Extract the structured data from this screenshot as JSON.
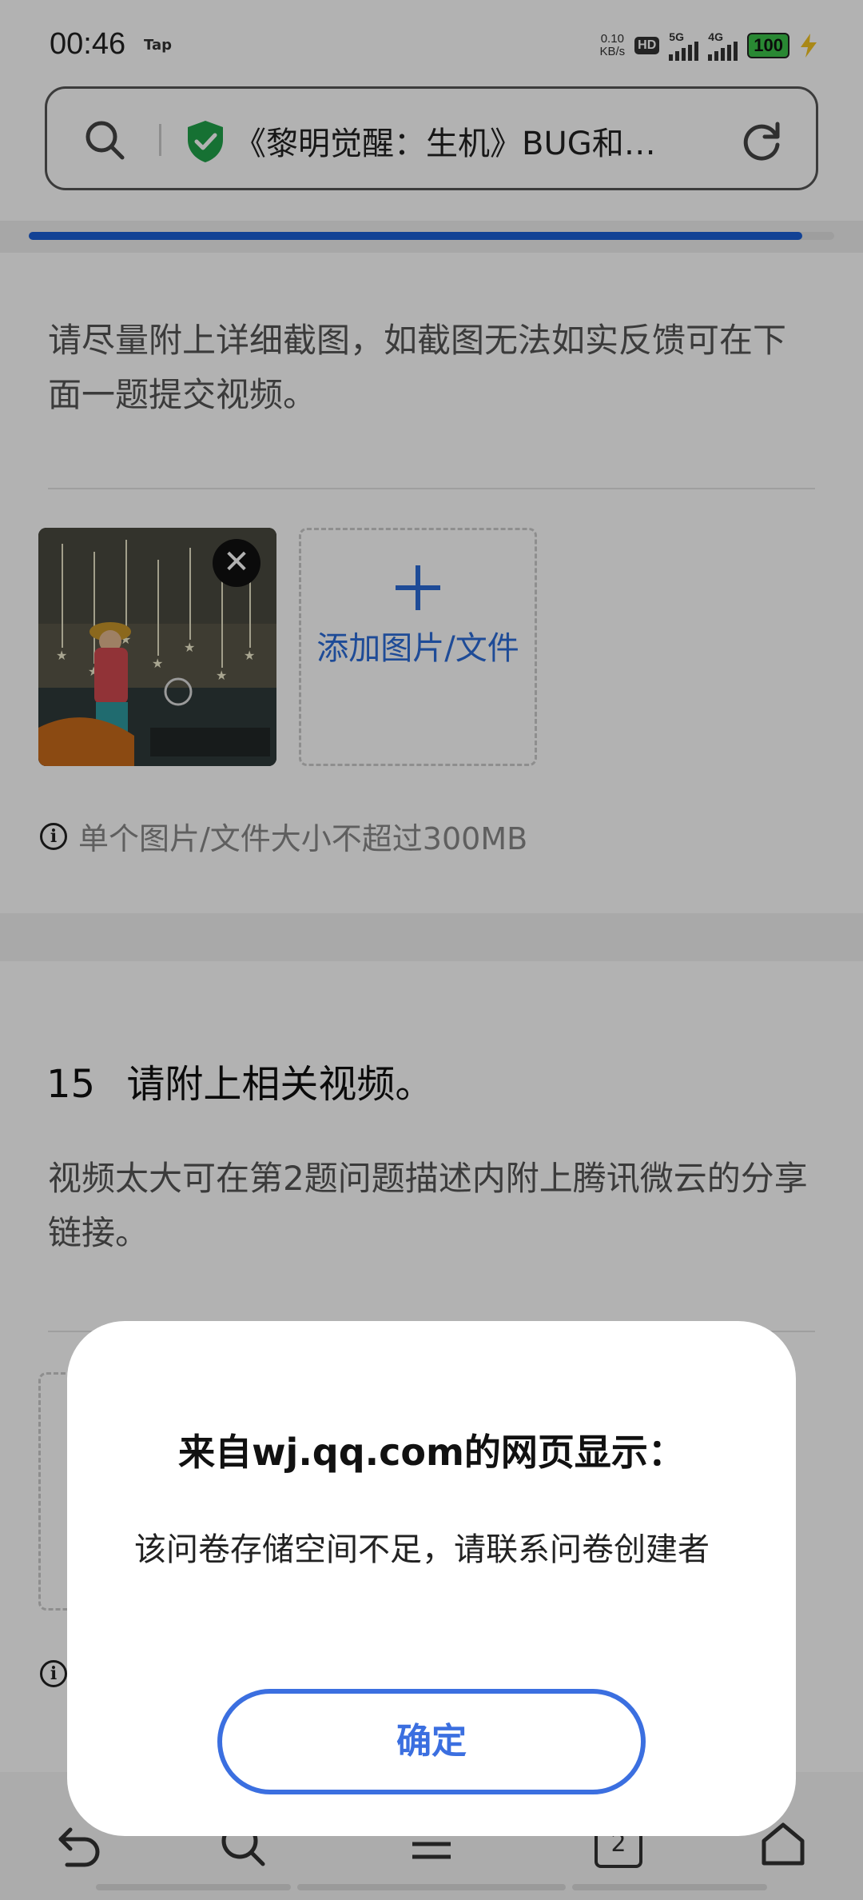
{
  "status_bar": {
    "time": "00:46",
    "tap_label": "Tap",
    "net_speed_value": "0.10",
    "net_speed_unit": "KB/s",
    "hd": "HD",
    "sim1_network": "5G",
    "sim2_network": "4G",
    "battery": "100"
  },
  "url_bar": {
    "title": "《黎明觉醒：生机》BUG和…",
    "secure_icon": "shield-check-icon",
    "security_color": "#20a24a"
  },
  "page_load_progress": 0.96,
  "question_13": {
    "description": "请尽量附上详细截图，如截图无法如实反馈可在下面一题提交视频。",
    "add_file_label": "添加图片/文件",
    "size_note": "单个图片/文件大小不超过300MB"
  },
  "question_14": {
    "number": "15",
    "title": "请附上相关视频。",
    "description": "视频太大可在第2题问题描述内附上腾讯微云的分享链接。"
  },
  "dialog": {
    "title": "来自wj.qq.com的网页显示：",
    "message": "该问卷存储空间不足，请联系问卷创建者",
    "ok_label": "确定",
    "accent_color": "#3b6fe0"
  },
  "bottom_nav": {
    "tab_count": "2"
  },
  "accent_link_color": "#2c6cd8"
}
